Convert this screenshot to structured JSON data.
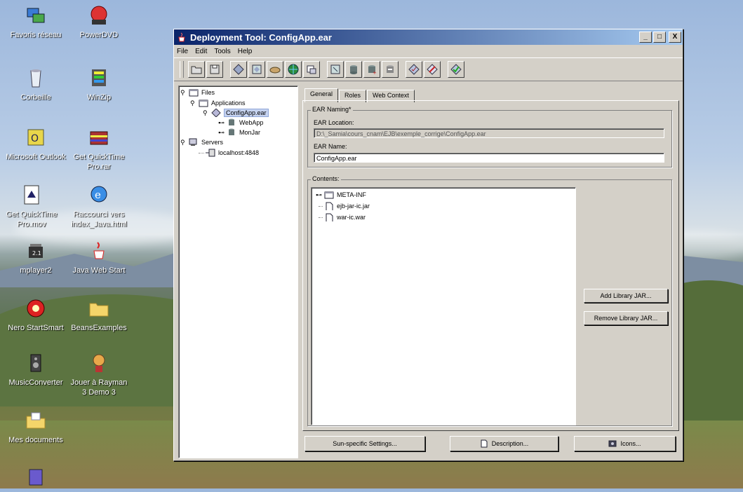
{
  "desktop": {
    "icons": [
      {
        "label": "Favoris réseau"
      },
      {
        "label": "PowerDVD"
      },
      {
        "label": "Corbeille"
      },
      {
        "label": "WinZip"
      },
      {
        "label": "Microsoft Outlook"
      },
      {
        "label": "Get QuickTime Pro.rar"
      },
      {
        "label": "Get QuickTime Pro.mov"
      },
      {
        "label": "Raccourci vers index_Java.html"
      },
      {
        "label": "mplayer2"
      },
      {
        "label": "Java Web Start"
      },
      {
        "label": "Nero StartSmart"
      },
      {
        "label": "BeansExamples"
      },
      {
        "label": "MusicConverter"
      },
      {
        "label": "Jouer à Rayman 3 Demo 3"
      },
      {
        "label": "Mes documents"
      }
    ]
  },
  "window": {
    "title": "Deployment Tool: ConfigApp.ear",
    "controls": {
      "minimize": "_",
      "maximize": "□",
      "close": "X"
    }
  },
  "menubar": [
    "File",
    "Edit",
    "Tools",
    "Help"
  ],
  "tree": {
    "files": "Files",
    "applications": "Applications",
    "configapp": "ConfigApp.ear",
    "webapp": "WebApp",
    "monjar": "MonJar",
    "servers": "Servers",
    "localhost": "localhost:4848"
  },
  "tabs": [
    "General",
    "Roles",
    "Web Context"
  ],
  "general": {
    "naming_title": "EAR Naming*",
    "location_label": "EAR Location:",
    "location_value": "D:\\_Samia\\cours_cnam\\EJB\\exemple_corrige\\ConfigApp.ear",
    "name_label": "EAR Name:",
    "name_value": "ConfigApp.ear",
    "contents_title": "Contents:",
    "contents": [
      {
        "name": "META-INF"
      },
      {
        "name": "ejb-jar-ic.jar"
      },
      {
        "name": "war-ic.war"
      }
    ],
    "add_library": "Add Library JAR...",
    "remove_library": "Remove Library JAR...",
    "sun_settings": "Sun-specific Settings...",
    "description": "Description...",
    "icons": "Icons..."
  }
}
